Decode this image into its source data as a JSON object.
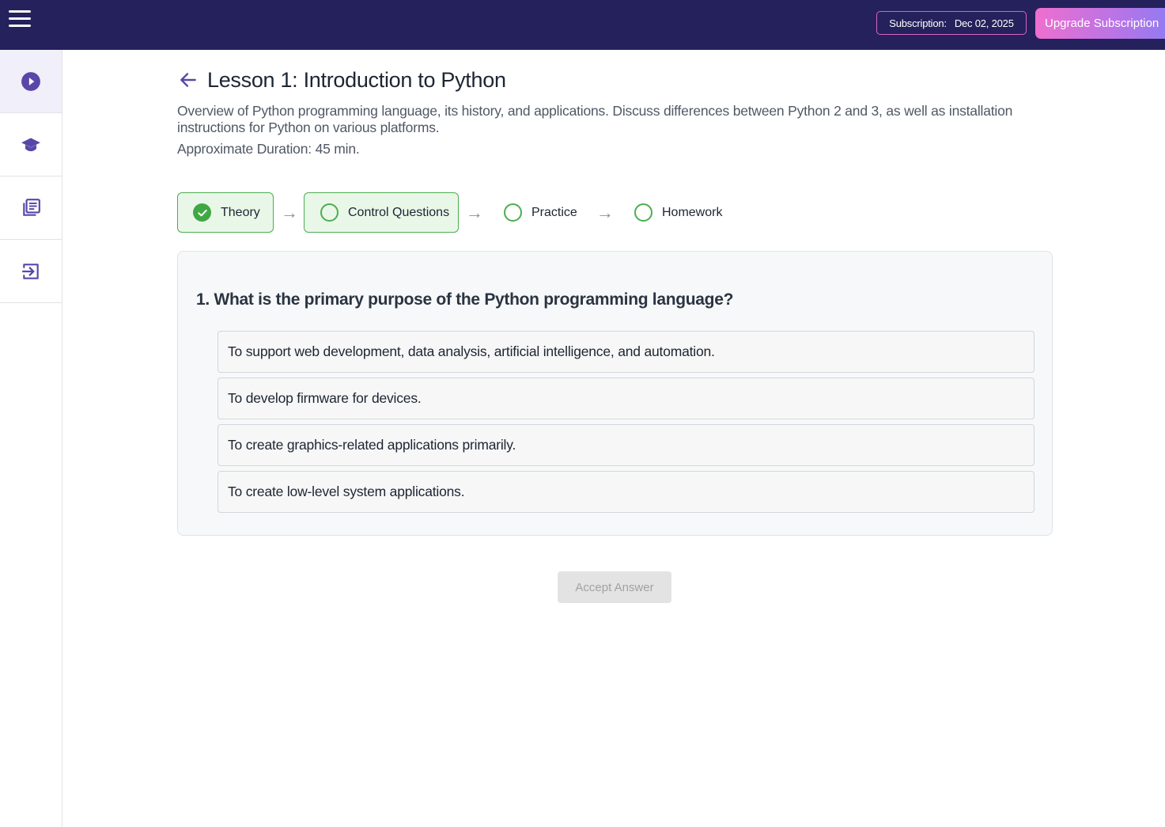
{
  "topbar": {
    "subscription_label": "Subscription:",
    "subscription_date": "Dec 02, 2025",
    "upgrade_label": "Upgrade Subscription"
  },
  "sidebar": {
    "items": [
      {
        "icon": "play-circle-icon",
        "active": true
      },
      {
        "icon": "graduation-cap-icon",
        "active": false
      },
      {
        "icon": "library-books-icon",
        "active": false
      },
      {
        "icon": "logout-icon",
        "active": false
      }
    ]
  },
  "lesson": {
    "title": "Lesson 1: Introduction to Python",
    "description": "Overview of Python programming language, its history, and applications. Discuss differences between Python 2 and 3, as well as installation instructions for Python on various platforms.",
    "duration": "Approximate Duration: 45 min."
  },
  "steps": [
    {
      "label": "Theory",
      "status": "completed"
    },
    {
      "label": "Control Questions",
      "status": "current"
    },
    {
      "label": "Practice",
      "status": "pending"
    },
    {
      "label": "Homework",
      "status": "pending"
    }
  ],
  "step_arrow": "→",
  "question": {
    "text": "1. What is the primary purpose of the Python programming language?",
    "options": [
      "To support web development, data analysis, artificial intelligence, and automation.",
      "To develop firmware for devices.",
      "To create graphics-related applications primarily.",
      "To create low-level system applications."
    ]
  },
  "accept_label": "Accept Answer",
  "colors": {
    "topbar_bg": "#25215c",
    "accent_purple": "#5a46a8",
    "step_green": "#4cae4f"
  }
}
